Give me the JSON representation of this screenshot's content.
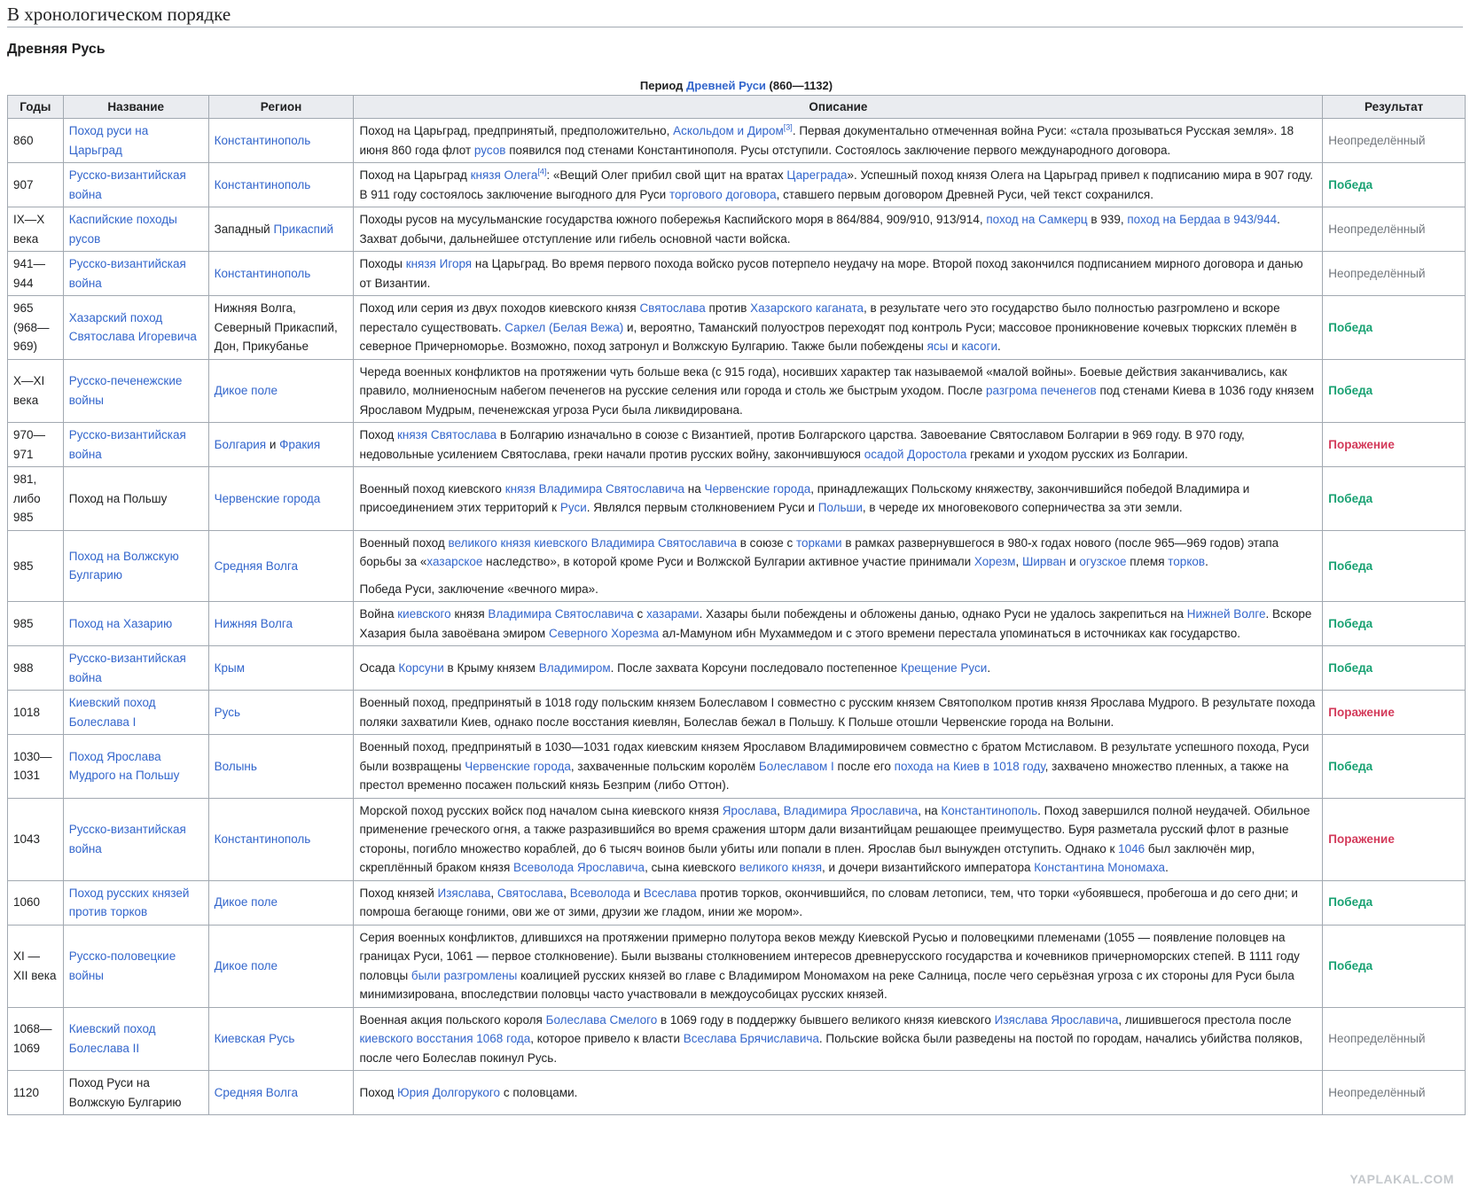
{
  "heading": "В хронологическом порядке",
  "subheading": "Древняя Русь",
  "caption": {
    "pre": "Период ",
    "link": "Древней Руси",
    "post": " (860—1132)"
  },
  "columns": [
    "Годы",
    "Название",
    "Регион",
    "Описание",
    "Результат"
  ],
  "watermark": "YAPLAKAL.COM",
  "colors": {
    "link": "#3366cc",
    "victory": "#18a172",
    "defeat": "#d33a5a",
    "neutral": "#72777d",
    "header_bg": "#eaecf0",
    "border": "#a2a9b1"
  },
  "rows": [
    {
      "years": "860",
      "result": "Неопределённый",
      "rt": "neu",
      "name": [
        {
          "t": "Поход руси на Царьград",
          "l": true
        }
      ],
      "region": [
        {
          "t": "Константинополь",
          "l": true
        }
      ],
      "desc": [
        [
          {
            "t": "Поход на Царьград, предпринятый, предположительно, "
          },
          {
            "t": "Аскольдом и Диром",
            "l": true
          },
          {
            "t": "[3]",
            "s": true
          },
          {
            "t": ". Первая документально отмеченная война Руси: «стала прозываться Русская земля». 18 июня 860 года флот "
          },
          {
            "t": "русов",
            "l": true
          },
          {
            "t": " появился под стенами Константинополя. Русы отступили. Состоялось заключение первого международного договора."
          }
        ]
      ]
    },
    {
      "years": "907",
      "result": "Победа",
      "rt": "win",
      "name": [
        {
          "t": "Русско-византийская война",
          "l": true
        }
      ],
      "region": [
        {
          "t": "Константинополь",
          "l": true
        }
      ],
      "desc": [
        [
          {
            "t": "Поход на Царьград "
          },
          {
            "t": "князя Олега",
            "l": true
          },
          {
            "t": "[4]",
            "s": true
          },
          {
            "t": ": «Вещий Олег прибил свой щит на вратах "
          },
          {
            "t": "Цареграда",
            "l": true
          },
          {
            "t": "». Успешный поход князя Олега на Царьград привел к подписанию мира в 907 году. В 911 году состоялось заключение выгодного для Руси "
          },
          {
            "t": "торгового договора",
            "l": true
          },
          {
            "t": ", ставшего первым договором Древней Руси, чей текст сохранился."
          }
        ]
      ]
    },
    {
      "years": "IX—X века",
      "result": "Неопределённый",
      "rt": "neu",
      "name": [
        {
          "t": "Каспийские походы русов",
          "l": true
        }
      ],
      "region": [
        {
          "t": "Западный "
        },
        {
          "t": "Прикаспий",
          "l": true
        }
      ],
      "desc": [
        [
          {
            "t": "Походы русов на мусульманские государства южного побережья Каспийского моря в 864/884, 909/910, 913/914, "
          },
          {
            "t": "поход на Самкерц",
            "l": true
          },
          {
            "t": " в 939, "
          },
          {
            "t": "поход на Бердаа в 943/944",
            "l": true
          },
          {
            "t": ". Захват добычи, дальнейшее отступление или гибель основной части войска."
          }
        ]
      ]
    },
    {
      "years": "941—944",
      "result": "Неопределённый",
      "rt": "neu",
      "name": [
        {
          "t": "Русско-византийская война",
          "l": true
        }
      ],
      "region": [
        {
          "t": "Константинополь",
          "l": true
        }
      ],
      "desc": [
        [
          {
            "t": "Походы "
          },
          {
            "t": "князя Игоря",
            "l": true
          },
          {
            "t": " на Царьград. Во время первого похода войско русов потерпело неудачу на море. Второй поход закончился подписанием мирного договора и данью от Византии."
          }
        ]
      ]
    },
    {
      "years": "965 (968—969)",
      "result": "Победа",
      "rt": "win",
      "name": [
        {
          "t": "Хазарский поход Святослава Игоревича",
          "l": true
        }
      ],
      "region": [
        {
          "t": "Нижняя Волга, Северный Прикаспий, Дон, Прикубанье"
        }
      ],
      "desc": [
        [
          {
            "t": "Поход или серия из двух походов киевского князя "
          },
          {
            "t": "Святослава",
            "l": true
          },
          {
            "t": " против "
          },
          {
            "t": "Хазарского каганата",
            "l": true
          },
          {
            "t": ", в результате чего это государство было полностью разгромлено и вскоре перестало существовать. "
          },
          {
            "t": "Саркел (Белая Вежа)",
            "l": true
          },
          {
            "t": " и, вероятно, Таманский полуостров переходят под контроль Руси; массовое проникновение кочевых тюркских племён в северное Причерноморье. Возможно, поход затронул и Волжскую Булгарию. Также были побеждены "
          },
          {
            "t": "ясы",
            "l": true
          },
          {
            "t": " и "
          },
          {
            "t": "касоги",
            "l": true
          },
          {
            "t": "."
          }
        ]
      ]
    },
    {
      "years": "X—XI века",
      "result": "Победа",
      "rt": "win",
      "name": [
        {
          "t": "Русско-печенежские войны",
          "l": true
        }
      ],
      "region": [
        {
          "t": "Дикое поле",
          "l": true
        }
      ],
      "desc": [
        [
          {
            "t": "Череда военных конфликтов на протяжении чуть больше века (с 915 года), носивших характер так называемой «малой войны». Боевые действия заканчивались, как правило, молниеносным набегом печенегов на русские селения или города и столь же быстрым уходом. После "
          },
          {
            "t": "разгрома печенегов",
            "l": true
          },
          {
            "t": " под стенами Киева в 1036 году князем Ярославом Мудрым, печенежская угроза Руси была ликвидирована."
          }
        ]
      ]
    },
    {
      "years": "970—971",
      "result": "Поражение",
      "rt": "loss",
      "name": [
        {
          "t": "Русско-византийская война",
          "l": true
        }
      ],
      "region": [
        {
          "t": "Болгария",
          "l": true
        },
        {
          "t": " и "
        },
        {
          "t": "Фракия",
          "l": true
        }
      ],
      "desc": [
        [
          {
            "t": "Поход "
          },
          {
            "t": "князя Святослава",
            "l": true
          },
          {
            "t": " в Болгарию изначально в союзе с Византией, против Болгарского царства. Завоевание Святославом Болгарии в 969 году. В 970 году, недовольные усилением Святослава, греки начали против русских войну, закончившуюся "
          },
          {
            "t": "осадой Доростола",
            "l": true
          },
          {
            "t": " греками и уходом русских из Болгарии."
          }
        ]
      ]
    },
    {
      "years": "981, либо 985",
      "result": "Победа",
      "rt": "win",
      "name": [
        {
          "t": "Поход на Польшу"
        }
      ],
      "region": [
        {
          "t": "Червенские города",
          "l": true
        }
      ],
      "desc": [
        [
          {
            "t": "Военный поход киевского "
          },
          {
            "t": "князя Владимира Святославича",
            "l": true
          },
          {
            "t": " на "
          },
          {
            "t": "Червенские города",
            "l": true
          },
          {
            "t": ", принадлежащих Польскому княжеству, закончившийся победой Владимира и присоединением этих территорий к "
          },
          {
            "t": "Руси",
            "l": true
          },
          {
            "t": ". Являлся первым столкновением Руси и "
          },
          {
            "t": "Польши",
            "l": true
          },
          {
            "t": ", в череде их многовекового соперничества за эти земли."
          }
        ]
      ]
    },
    {
      "years": "985",
      "result": "Победа",
      "rt": "win",
      "name": [
        {
          "t": "Поход на Волжскую Булгарию",
          "l": true
        }
      ],
      "region": [
        {
          "t": "Средняя Волга",
          "l": true
        }
      ],
      "desc": [
        [
          {
            "t": "Военный поход "
          },
          {
            "t": "великого князя киевского Владимира Святославича",
            "l": true
          },
          {
            "t": " в союзе с "
          },
          {
            "t": "торками",
            "l": true
          },
          {
            "t": " в рамках развернувшегося в 980-х годах нового (после 965—969 годов) этапа борьбы за «"
          },
          {
            "t": "хазарское",
            "l": true
          },
          {
            "t": " наследство», в которой кроме Руси и Волжской Булгарии активное участие принимали "
          },
          {
            "t": "Хорезм",
            "l": true
          },
          {
            "t": ", "
          },
          {
            "t": "Ширван",
            "l": true
          },
          {
            "t": " и "
          },
          {
            "t": "огузское",
            "l": true
          },
          {
            "t": " племя "
          },
          {
            "t": "торков",
            "l": true
          },
          {
            "t": "."
          }
        ],
        [
          {
            "t": "Победа Руси, заключение «вечного мира»."
          }
        ]
      ]
    },
    {
      "years": "985",
      "result": "Победа",
      "rt": "win",
      "name": [
        {
          "t": "Поход на Хазарию",
          "l": true
        }
      ],
      "region": [
        {
          "t": "Нижняя Волга",
          "l": true
        }
      ],
      "desc": [
        [
          {
            "t": "Война "
          },
          {
            "t": "киевского",
            "l": true
          },
          {
            "t": " князя "
          },
          {
            "t": "Владимира Святославича",
            "l": true
          },
          {
            "t": " с "
          },
          {
            "t": "хазарами",
            "l": true
          },
          {
            "t": ". Хазары были побеждены и обложены данью, однако Руси не удалось закрепиться на "
          },
          {
            "t": "Нижней Волге",
            "l": true
          },
          {
            "t": ". Вскоре Хазария была завоёвана эмиром "
          },
          {
            "t": "Северного Хорезма",
            "l": true
          },
          {
            "t": " ал-Мамуном ибн Мухаммедом и с этого времени перестала упоминаться в источниках как государство."
          }
        ]
      ]
    },
    {
      "years": "988",
      "result": "Победа",
      "rt": "win",
      "name": [
        {
          "t": "Русско-византийская война",
          "l": true
        }
      ],
      "region": [
        {
          "t": "Крым",
          "l": true
        }
      ],
      "desc": [
        [
          {
            "t": "Осада "
          },
          {
            "t": "Корсуни",
            "l": true
          },
          {
            "t": " в Крыму князем "
          },
          {
            "t": "Владимиром",
            "l": true
          },
          {
            "t": ". После захвата Корсуни последовало постепенное "
          },
          {
            "t": "Крещение Руси",
            "l": true
          },
          {
            "t": "."
          }
        ]
      ]
    },
    {
      "years": "1018",
      "result": "Поражение",
      "rt": "loss",
      "name": [
        {
          "t": "Киевский поход Болеслава I",
          "l": true
        }
      ],
      "region": [
        {
          "t": "Русь",
          "l": true
        }
      ],
      "desc": [
        [
          {
            "t": "Военный поход, предпринятый в 1018 году польским князем Болеславом I совместно с русским князем Святополком против князя Ярослава Мудрого. В результате похода поляки захватили Киев, однако после восстания киевлян, Болеслав бежал в Польшу. К Польше отошли Червенские города на Волыни."
          }
        ]
      ]
    },
    {
      "years": "1030—1031",
      "result": "Победа",
      "rt": "win",
      "name": [
        {
          "t": "Поход Ярослава Мудрого на Польшу",
          "l": true
        }
      ],
      "region": [
        {
          "t": "Волынь",
          "l": true
        }
      ],
      "desc": [
        [
          {
            "t": "Военный поход, предпринятый в 1030—1031 годах киевским князем Ярославом Владимировичем совместно с братом Мстиславом. В результате успешного похода, Руси были возвращены "
          },
          {
            "t": "Червенские города",
            "l": true
          },
          {
            "t": ", захваченные польским королём "
          },
          {
            "t": "Болеславом I",
            "l": true
          },
          {
            "t": " после его "
          },
          {
            "t": "похода на Киев в 1018 году",
            "l": true
          },
          {
            "t": ", захвачено множество пленных, а также на престол временно посажен польский князь Безприм (либо Оттон)."
          }
        ]
      ]
    },
    {
      "years": "1043",
      "result": "Поражение",
      "rt": "loss",
      "name": [
        {
          "t": "Русско-византийская война",
          "l": true
        }
      ],
      "region": [
        {
          "t": "Константинополь",
          "l": true
        }
      ],
      "desc": [
        [
          {
            "t": "Морской поход русских войск под началом сына киевского князя "
          },
          {
            "t": "Ярослава",
            "l": true
          },
          {
            "t": ", "
          },
          {
            "t": "Владимира Ярославича",
            "l": true
          },
          {
            "t": ", на "
          },
          {
            "t": "Константинополь",
            "l": true
          },
          {
            "t": ". Поход завершился полной неудачей. Обильное применение греческого огня, а также разразившийся во время сражения шторм дали византийцам решающее преимущество. Буря разметала русский флот в разные стороны, погибло множество кораблей, до 6 тысяч воинов были убиты или попали в плен. Ярослав был вынужден отступить. Однако к "
          },
          {
            "t": "1046",
            "l": true
          },
          {
            "t": " был заключён мир, скреплённый браком князя "
          },
          {
            "t": "Всеволода Ярославича",
            "l": true
          },
          {
            "t": ", сына киевского "
          },
          {
            "t": "великого князя",
            "l": true
          },
          {
            "t": ", и дочери византийского императора "
          },
          {
            "t": "Константина Мономаха",
            "l": true
          },
          {
            "t": "."
          }
        ]
      ]
    },
    {
      "years": "1060",
      "result": "Победа",
      "rt": "win",
      "name": [
        {
          "t": "Поход русских князей против торков",
          "l": true
        }
      ],
      "region": [
        {
          "t": "Дикое поле",
          "l": true
        }
      ],
      "desc": [
        [
          {
            "t": "Поход князей "
          },
          {
            "t": "Изяслава",
            "l": true
          },
          {
            "t": ", "
          },
          {
            "t": "Святослава",
            "l": true
          },
          {
            "t": ", "
          },
          {
            "t": "Всеволода",
            "l": true
          },
          {
            "t": " и "
          },
          {
            "t": "Всеслава",
            "l": true
          },
          {
            "t": " против торков, окончившийся, по словам летописи, тем, что торки «убоявшеся, пробегоша и до сего дни; и помроша бегающе гоними, ови же от зими, друзии же гладом, инии же мором»."
          }
        ]
      ]
    },
    {
      "years": "XI — XII века",
      "result": "Победа",
      "rt": "win",
      "name": [
        {
          "t": "Русско-половецкие войны",
          "l": true
        }
      ],
      "region": [
        {
          "t": "Дикое поле",
          "l": true
        }
      ],
      "desc": [
        [
          {
            "t": "Серия военных конфликтов, длившихся на протяжении примерно полутора веков между Киевской Русью и половецкими племенами (1055 — появление половцев на границах Руси, 1061 — первое столкновение). Были вызваны столкновением интересов древнерусского государства и кочевников причерноморских степей. В 1111 году половцы "
          },
          {
            "t": "были разгромлены",
            "l": true
          },
          {
            "t": " коалицией русских князей во главе с Владимиром Мономахом на реке Салница, после чего серьёзная угроза с их стороны для Руси была минимизирована, впоследствии половцы часто участвовали в междоусобицах русских князей."
          }
        ]
      ]
    },
    {
      "years": "1068—1069",
      "result": "Неопределённый",
      "rt": "neu",
      "name": [
        {
          "t": "Киевский поход Болеслава II",
          "l": true
        }
      ],
      "region": [
        {
          "t": "Киевская Русь",
          "l": true
        }
      ],
      "desc": [
        [
          {
            "t": "Военная акция польского короля "
          },
          {
            "t": "Болеслава Смелого",
            "l": true
          },
          {
            "t": " в 1069 году в поддержку бывшего великого князя киевского "
          },
          {
            "t": "Изяслава Ярославича",
            "l": true
          },
          {
            "t": ", лишившегося престола после "
          },
          {
            "t": "киевского восстания 1068 года",
            "l": true
          },
          {
            "t": ", которое привело к власти "
          },
          {
            "t": "Всеслава Брячиславича",
            "l": true
          },
          {
            "t": ". Польские войска были разведены на постой по городам, начались убийства поляков, после чего Болеслав покинул Русь."
          }
        ]
      ]
    },
    {
      "years": "1120",
      "result": "Неопределённый",
      "rt": "neu",
      "name": [
        {
          "t": "Поход Руси на Волжскую Булгарию"
        }
      ],
      "region": [
        {
          "t": "Средняя Волга",
          "l": true
        }
      ],
      "desc": [
        [
          {
            "t": "Поход "
          },
          {
            "t": "Юрия Долгорукого",
            "l": true
          },
          {
            "t": " с половцами."
          }
        ]
      ]
    }
  ]
}
